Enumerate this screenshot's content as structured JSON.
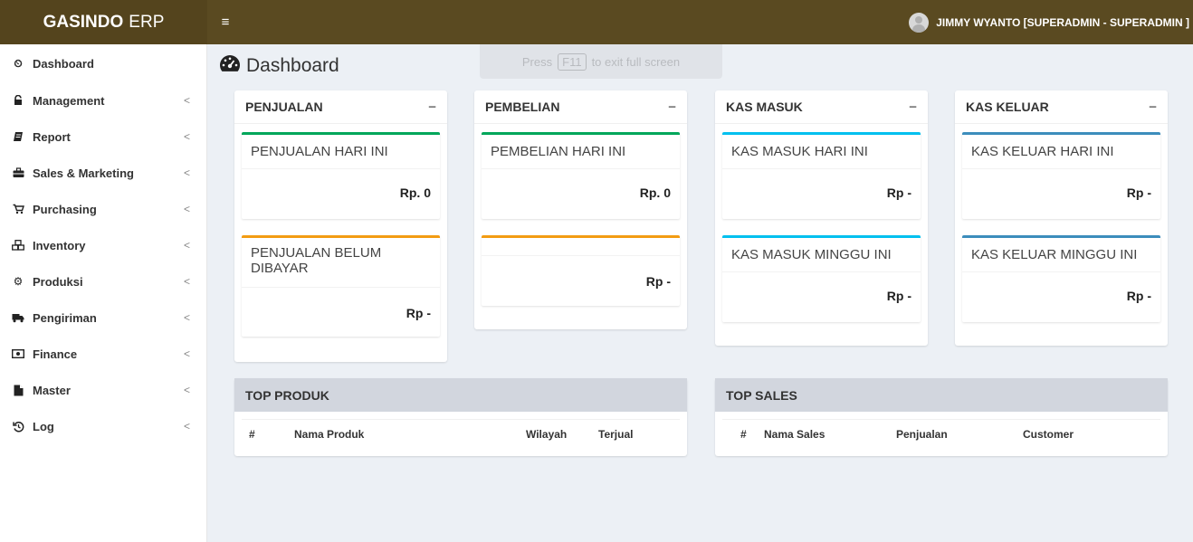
{
  "header": {
    "logo_bold": "GASINDO",
    "logo_light": "ERP",
    "toggle_icon": "≡",
    "user_name": "JIMMY WYANTO [SUPERADMIN - SUPERADMIN ]"
  },
  "sidebar": {
    "items": [
      {
        "label": "Dashboard",
        "icon": "dashboard-icon",
        "glyph": "⏲"
      },
      {
        "label": "Management",
        "icon": "lock-icon",
        "glyph": "🔒"
      },
      {
        "label": "Report",
        "icon": "book-icon",
        "glyph": "▰"
      },
      {
        "label": "Sales & Marketing",
        "icon": "briefcase-icon",
        "glyph": "▬"
      },
      {
        "label": "Purchasing",
        "icon": "cart-icon",
        "glyph": "⛟"
      },
      {
        "label": "Inventory",
        "icon": "cubes-icon",
        "glyph": "❖"
      },
      {
        "label": "Produksi",
        "icon": "cogs-icon",
        "glyph": "⚙"
      },
      {
        "label": "Pengiriman",
        "icon": "truck-icon",
        "glyph": "⛟"
      },
      {
        "label": "Finance",
        "icon": "money-icon",
        "glyph": "▣"
      },
      {
        "label": "Master",
        "icon": "file-icon",
        "glyph": "▙"
      },
      {
        "label": "Log",
        "icon": "history-icon",
        "glyph": "↺"
      }
    ],
    "arrow": "<"
  },
  "fullscreen_hint": {
    "press": "Press",
    "key": "F11",
    "rest": "to exit full screen"
  },
  "page": {
    "title": "Dashboard"
  },
  "cards": {
    "penjualan": {
      "title": "PENJUALAN",
      "min": "−",
      "hari_ini_title": "PENJUALAN HARI INI",
      "hari_ini_value": "Rp. 0",
      "belum_title": "PENJUALAN BELUM DIBAYAR",
      "belum_value": "Rp -"
    },
    "pembelian": {
      "title": "PEMBELIAN",
      "min": "−",
      "hari_ini_title": "PEMBELIAN HARI INI",
      "hari_ini_value": "Rp. 0",
      "second_title": "",
      "second_value": "Rp -"
    },
    "kas_masuk": {
      "title": "KAS MASUK",
      "min": "−",
      "hari_ini_title": "KAS MASUK HARI INI",
      "hari_ini_value": "Rp -",
      "minggu_title": "KAS MASUK MINGGU INI",
      "minggu_value": "Rp -"
    },
    "kas_keluar": {
      "title": "KAS KELUAR",
      "min": "−",
      "hari_ini_title": "KAS KELUAR HARI INI",
      "hari_ini_value": "Rp -",
      "minggu_title": "KAS KELUAR MINGGU INI",
      "minggu_value": "Rp -"
    }
  },
  "top_produk": {
    "title": "TOP PRODUK",
    "columns": [
      "#",
      "Nama Produk",
      "Wilayah",
      "Terjual"
    ]
  },
  "top_sales": {
    "title": "TOP SALES",
    "columns": [
      "#",
      "Nama Sales",
      "Penjualan",
      "Customer"
    ]
  },
  "colors": {
    "header_bg": "#5a4a21",
    "logo_bg": "#54441d",
    "green": "#00a65a",
    "orange": "#f39c12",
    "cyan": "#00c0ef",
    "blue": "#3c8dbc"
  }
}
